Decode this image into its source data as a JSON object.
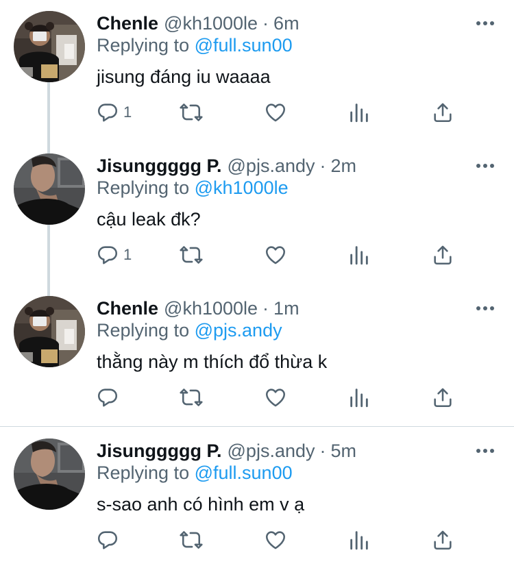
{
  "colors": {
    "text": "#0f1419",
    "secondary": "#536471",
    "link": "#1d9bf0",
    "line": "#cfd9de"
  },
  "tweets": [
    {
      "name": "Chenle",
      "handle": "@kh1000le",
      "separator": "·",
      "time": "6m",
      "replying_prefix": "Replying to",
      "replying_to": "@full.sun00",
      "text": "jisung đáng iu waaaa",
      "reply_count": "1",
      "avatar_icon": "chenle-avatar"
    },
    {
      "name": "Jisunggggg P.",
      "handle": "@pjs.andy",
      "separator": "·",
      "time": "2m",
      "replying_prefix": "Replying to",
      "replying_to": "@kh1000le",
      "text": "cậu leak đk?",
      "reply_count": "1",
      "avatar_icon": "jisung-avatar"
    },
    {
      "name": "Chenle",
      "handle": "@kh1000le",
      "separator": "·",
      "time": "1m",
      "replying_prefix": "Replying to",
      "replying_to": "@pjs.andy",
      "text": "thằng này m thích đổ thừa k",
      "reply_count": "",
      "avatar_icon": "chenle-avatar"
    },
    {
      "name": "Jisunggggg P.",
      "handle": "@pjs.andy",
      "separator": "·",
      "time": "5m",
      "replying_prefix": "Replying to",
      "replying_to": "@full.sun00",
      "text": "s-sao anh có hình em v ạ",
      "reply_count": "",
      "avatar_icon": "jisung-avatar"
    }
  ],
  "icons": [
    "reply-icon",
    "retweet-icon",
    "like-icon",
    "analytics-icon",
    "share-icon",
    "more-icon"
  ]
}
